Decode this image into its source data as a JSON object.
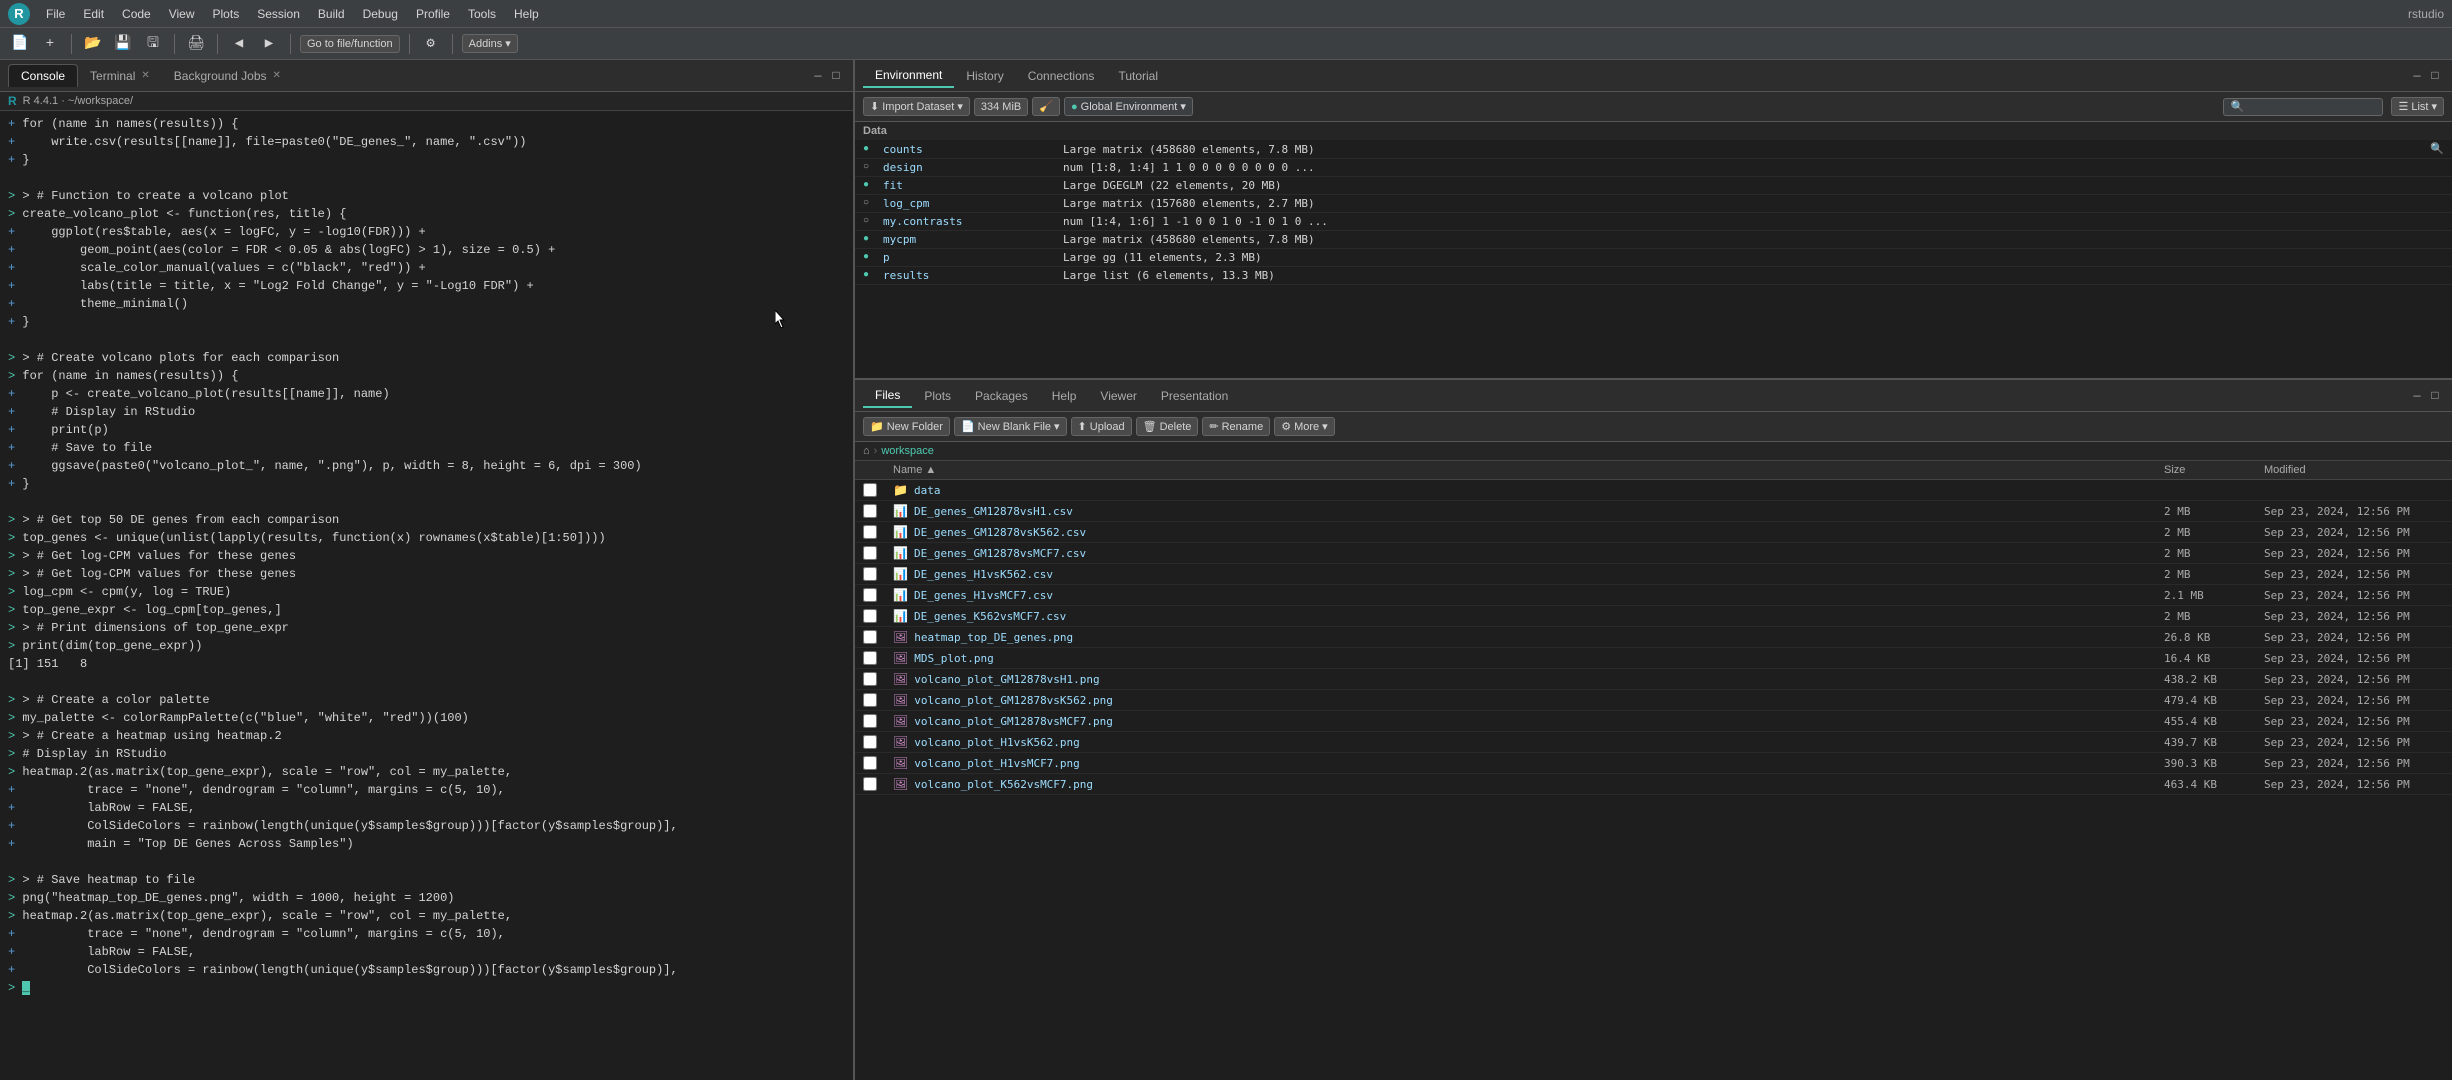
{
  "app": {
    "title": "rstudio",
    "r_logo": "R"
  },
  "menu": {
    "items": [
      "File",
      "Edit",
      "Code",
      "View",
      "Plots",
      "Session",
      "Build",
      "Debug",
      "Profile",
      "Tools",
      "Help"
    ]
  },
  "toolbar": {
    "new_file": "New File",
    "open": "Open",
    "save": "Save",
    "go_to_file": "Go to file/function",
    "addins": "Addins"
  },
  "left_panel": {
    "tabs": [
      {
        "label": "Console",
        "active": true
      },
      {
        "label": "Terminal",
        "active": false
      },
      {
        "label": "Background Jobs",
        "active": false
      }
    ],
    "r_path": "R 4.4.1 · ~/workspace/",
    "console_lines": [
      {
        "type": "continuation",
        "text": "+ for (name in names(results)) {"
      },
      {
        "type": "continuation",
        "text": "+     write.csv(results[[name]], file=paste0(\"DE_genes_\", name, \".csv\"))"
      },
      {
        "type": "continuation",
        "text": "+ }"
      },
      {
        "type": "blank"
      },
      {
        "type": "continuation",
        "text": "> > # Function to create a volcano plot"
      },
      {
        "type": "continuation",
        "text": "> create_volcano_plot <- function(res, title) {"
      },
      {
        "type": "continuation",
        "text": "+     ggplot(res$table, aes(x = logFC, y = -log10(FDR))) +"
      },
      {
        "type": "continuation",
        "text": "+         geom_point(aes(color = FDR < 0.05 & abs(logFC) > 1), size = 0.5) +"
      },
      {
        "type": "continuation",
        "text": "+         scale_color_manual(values = c(\"black\", \"red\")) +"
      },
      {
        "type": "continuation",
        "text": "+         labs(title = title, x = \"Log2 Fold Change\", y = \"-Log10 FDR\") +"
      },
      {
        "type": "continuation",
        "text": "+         theme_minimal()"
      },
      {
        "type": "continuation",
        "text": "+ }"
      },
      {
        "type": "blank"
      },
      {
        "type": "continuation",
        "text": "> > # Create volcano plots for each comparison"
      },
      {
        "type": "continuation",
        "text": "> for (name in names(results)) {"
      },
      {
        "type": "continuation",
        "text": "+     p <- create_volcano_plot(results[[name]], name)"
      },
      {
        "type": "continuation",
        "text": "+     # Display in RStudio"
      },
      {
        "type": "continuation",
        "text": "+     print(p)"
      },
      {
        "type": "continuation",
        "text": "+     # Save to file"
      },
      {
        "type": "continuation",
        "text": "+     ggsave(paste0(\"volcano_plot_\", name, \".png\"), p, width = 8, height = 6, dpi = 300)"
      },
      {
        "type": "continuation",
        "text": "+ }"
      },
      {
        "type": "blank"
      },
      {
        "type": "continuation",
        "text": "> > # Get top 50 DE genes from each comparison"
      },
      {
        "type": "continuation",
        "text": "> top_genes <- unique(unlist(lapply(results, function(x) rownames(x$table)[1:50])))"
      },
      {
        "type": "continuation",
        "text": "> > # Get log-CPM values for these genes"
      },
      {
        "type": "continuation",
        "text": "> > # Get log-CPM values for these genes"
      },
      {
        "type": "continuation",
        "text": "> log_cpm <- cpm(y, log = TRUE)"
      },
      {
        "type": "continuation",
        "text": "> top_gene_expr <- log_cpm[top_genes,]"
      },
      {
        "type": "continuation",
        "text": "> > # Print dimensions of top_gene_expr"
      },
      {
        "type": "continuation",
        "text": "> print(dim(top_gene_expr))"
      },
      {
        "type": "output",
        "text": "[1] 151   8"
      },
      {
        "type": "blank"
      },
      {
        "type": "continuation",
        "text": "> > # Create a color palette"
      },
      {
        "type": "continuation",
        "text": "> my_palette <- colorRampPalette(c(\"blue\", \"white\", \"red\"))(100)"
      },
      {
        "type": "continuation",
        "text": "> > # Create a heatmap using heatmap.2"
      },
      {
        "type": "continuation",
        "text": "> # Display in RStudio"
      },
      {
        "type": "continuation",
        "text": "> heatmap.2(as.matrix(top_gene_expr), scale = \"row\", col = my_palette,"
      },
      {
        "type": "continuation",
        "text": "+          trace = \"none\", dendrogram = \"column\", margins = c(5, 10),"
      },
      {
        "type": "continuation",
        "text": "+          labRow = FALSE,"
      },
      {
        "type": "continuation",
        "text": "+          ColSideColors = rainbow(length(unique(y$samples$group)))[factor(y$samples$group)],"
      },
      {
        "type": "continuation",
        "text": "+          main = \"Top DE Genes Across Samples\")"
      },
      {
        "type": "blank"
      },
      {
        "type": "continuation",
        "text": "> > # Save heatmap to file"
      },
      {
        "type": "continuation",
        "text": "> png(\"heatmap_top_DE_genes.png\", width = 1000, height = 1200)"
      },
      {
        "type": "continuation",
        "text": "> heatmap.2(as.matrix(top_gene_expr), scale = \"row\", col = my_palette,"
      },
      {
        "type": "continuation",
        "text": "+          trace = \"none\", dendrogram = \"column\", margins = c(5, 10),"
      },
      {
        "type": "continuation",
        "text": "+          labRow = FALSE,"
      },
      {
        "type": "continuation",
        "text": "+          ColSideColors = rainbow(length(unique(y$samples$group)))[factor(y$samples$group)],"
      }
    ]
  },
  "right_panel": {
    "env_tabs": [
      "Environment",
      "History",
      "Connections",
      "Tutorial"
    ],
    "env_active": "Environment",
    "env_toolbar": {
      "import": "Import Dataset",
      "memory": "334 MiB",
      "broom": "🧹",
      "global_env": "Global Environment",
      "list_view": "List"
    },
    "data_section": "Data",
    "env_data": [
      {
        "icon": "●",
        "name": "counts",
        "value": "Large matrix (458680 elements,  7.8 MB)",
        "has_zoom": true
      },
      {
        "icon": "○",
        "name": "design",
        "value": "num [1:8, 1:4] 1 1 0 0 0 0 0 0 0 0 ...",
        "has_zoom": false
      },
      {
        "icon": "●",
        "name": "fit",
        "value": "Large DGEGLM (22 elements,  20 MB)",
        "has_zoom": false
      },
      {
        "icon": "○",
        "name": "log_cpm",
        "value": "Large matrix (157680 elements,  2.7 MB)",
        "has_zoom": false
      },
      {
        "icon": "○",
        "name": "my.contrasts",
        "value": "num [1:4, 1:6] 1 -1 0 0 1 0 -1 0 1 0 ...",
        "has_zoom": false
      },
      {
        "icon": "●",
        "name": "mycpm",
        "value": "Large matrix (458680 elements,  7.8 MB)",
        "has_zoom": false
      },
      {
        "icon": "●",
        "name": "p",
        "value": "Large gg (11 elements,  2.3 MB)",
        "has_zoom": false
      },
      {
        "icon": "●",
        "name": "results",
        "value": "Large list (6 elements,  13.3 MB)",
        "has_zoom": false
      }
    ],
    "files_tabs": [
      "Files",
      "Plots",
      "Packages",
      "Help",
      "Viewer",
      "Presentation"
    ],
    "files_active": "Files",
    "files_toolbar": {
      "new_folder": "New Folder",
      "new_blank_file": "New Blank File",
      "upload": "Upload",
      "delete": "Delete",
      "rename": "Rename",
      "more": "More"
    },
    "breadcrumb": {
      "home": "⌂",
      "workspace": "workspace"
    },
    "files_headers": [
      "Name",
      "Size",
      "Modified"
    ],
    "files": [
      {
        "type": "folder",
        "name": "data",
        "size": "",
        "modified": ""
      },
      {
        "type": "csv",
        "name": "DE_genes_GM12878vsH1.csv",
        "size": "2 MB",
        "modified": "Sep 23, 2024, 12:56 PM"
      },
      {
        "type": "csv",
        "name": "DE_genes_GM12878vsK562.csv",
        "size": "2 MB",
        "modified": "Sep 23, 2024, 12:56 PM"
      },
      {
        "type": "csv",
        "name": "DE_genes_GM12878vsMCF7.csv",
        "size": "2 MB",
        "modified": "Sep 23, 2024, 12:56 PM"
      },
      {
        "type": "csv",
        "name": "DE_genes_H1vsK562.csv",
        "size": "2 MB",
        "modified": "Sep 23, 2024, 12:56 PM"
      },
      {
        "type": "csv",
        "name": "DE_genes_H1vsMCF7.csv",
        "size": "2.1 MB",
        "modified": "Sep 23, 2024, 12:56 PM"
      },
      {
        "type": "csv",
        "name": "DE_genes_K562vsMCF7.csv",
        "size": "2 MB",
        "modified": "Sep 23, 2024, 12:56 PM"
      },
      {
        "type": "png",
        "name": "heatmap_top_DE_genes.png",
        "size": "26.8 KB",
        "modified": "Sep 23, 2024, 12:56 PM"
      },
      {
        "type": "png",
        "name": "MDS_plot.png",
        "size": "16.4 KB",
        "modified": "Sep 23, 2024, 12:56 PM"
      },
      {
        "type": "png",
        "name": "volcano_plot_GM12878vsH1.png",
        "size": "438.2 KB",
        "modified": "Sep 23, 2024, 12:56 PM"
      },
      {
        "type": "png",
        "name": "volcano_plot_GM12878vsK562.png",
        "size": "479.4 KB",
        "modified": "Sep 23, 2024, 12:56 PM"
      },
      {
        "type": "png",
        "name": "volcano_plot_GM12878vsMCF7.png",
        "size": "455.4 KB",
        "modified": "Sep 23, 2024, 12:56 PM"
      },
      {
        "type": "png",
        "name": "volcano_plot_H1vsK562.png",
        "size": "439.7 KB",
        "modified": "Sep 23, 2024, 12:56 PM"
      },
      {
        "type": "png",
        "name": "volcano_plot_H1vsMCF7.png",
        "size": "390.3 KB",
        "modified": "Sep 23, 2024, 12:56 PM"
      },
      {
        "type": "png",
        "name": "volcano_plot_K562vsMCF7.png",
        "size": "463.4 KB",
        "modified": "Sep 23, 2024, 12:56 PM"
      }
    ]
  }
}
